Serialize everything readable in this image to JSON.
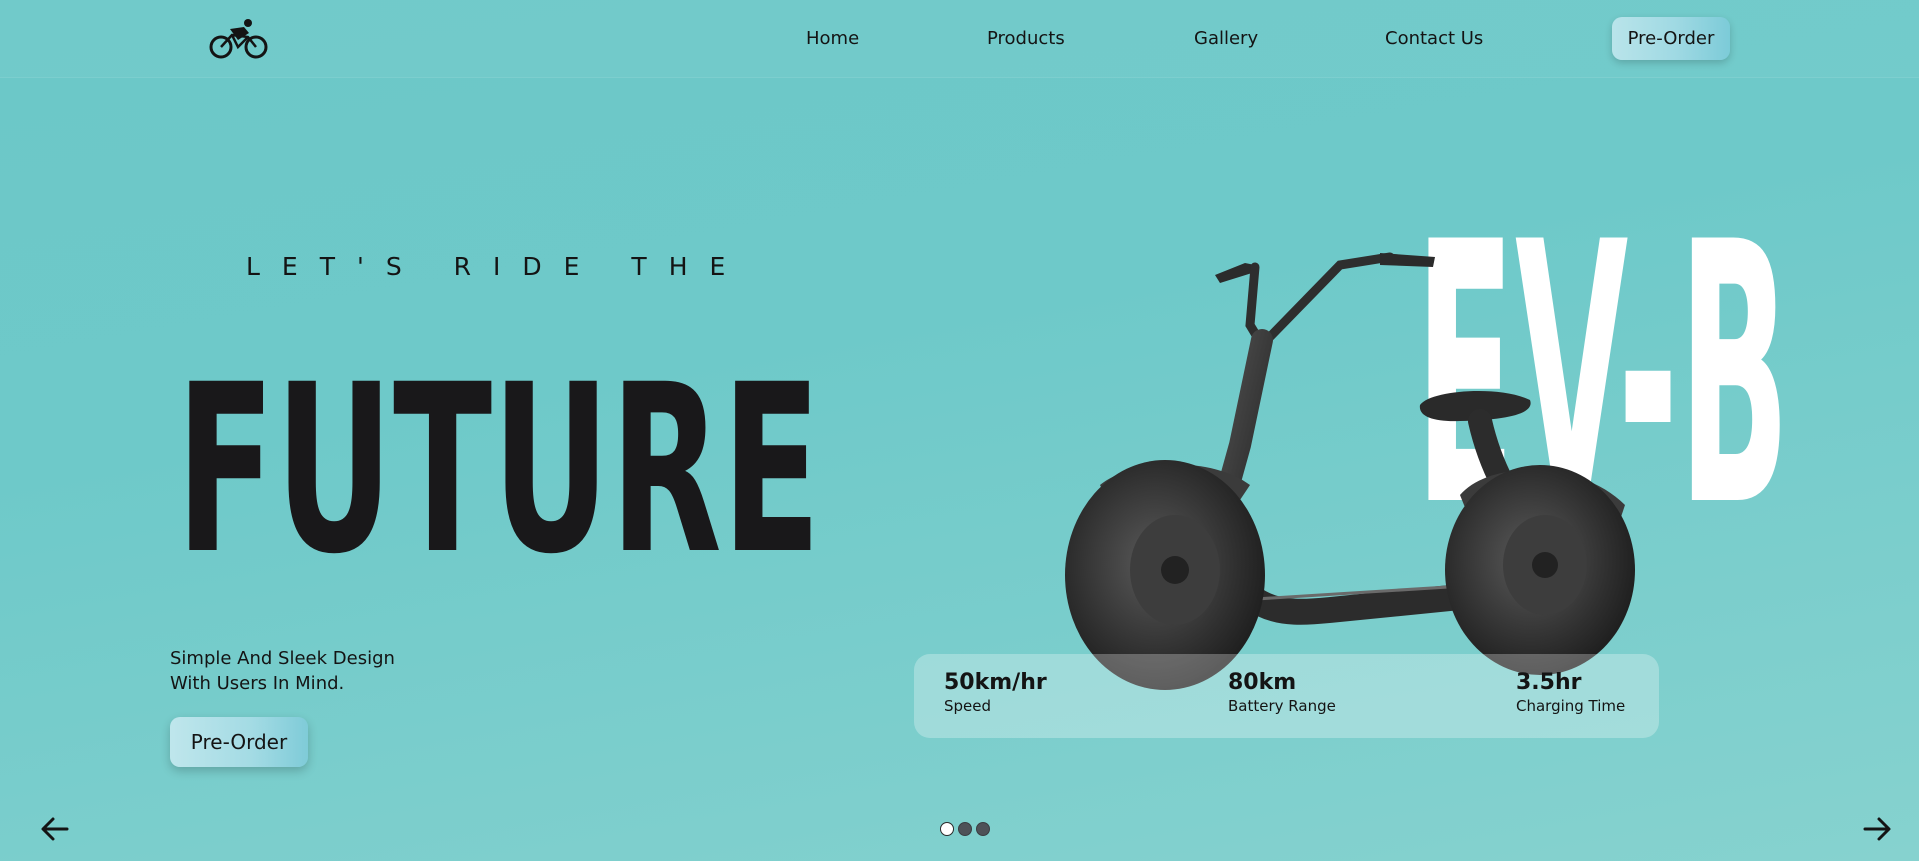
{
  "nav": {
    "logo_icon": "cyclist-icon",
    "links": [
      "Home",
      "Products",
      "Gallery",
      "Contact Us"
    ],
    "cta_label": "Pre-Order"
  },
  "hero": {
    "tagline": "LET'S RIDE THE",
    "title": "FUTURE",
    "subtitle_line1": "Simple And Sleek Design",
    "subtitle_line2": "With Users In Mind.",
    "cta_label": "Pre-Order",
    "model_name": "EV-B"
  },
  "specs": [
    {
      "value": "50km/hr",
      "label": "Speed"
    },
    {
      "value": "80km",
      "label": "Battery Range"
    },
    {
      "value": "3.5hr",
      "label": "Charging Time"
    }
  ],
  "carousel": {
    "slide_count": 3,
    "active_slide": 1,
    "prev_icon": "arrow-left-icon",
    "next_icon": "arrow-right-icon"
  },
  "colors": {
    "background": "#6ec9c9",
    "text": "#141414",
    "button_gradient_start": "#b9e4ea",
    "button_gradient_end": "#7ccbd8",
    "model_name": "#ffffff"
  }
}
